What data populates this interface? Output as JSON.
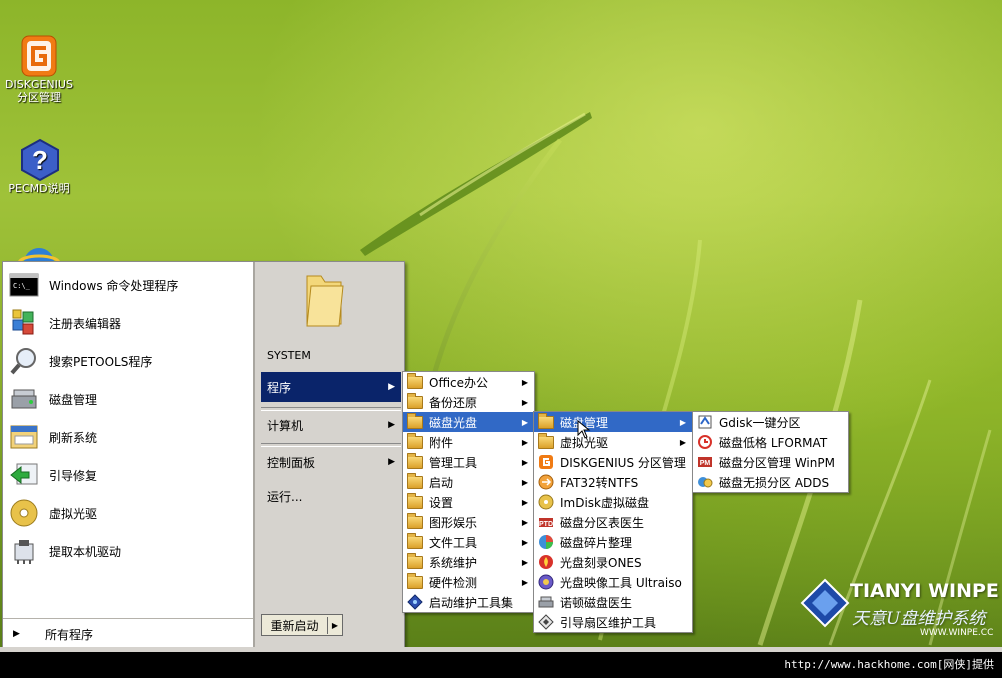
{
  "desktop": {
    "icons": [
      {
        "label1": "DISKGENIUS",
        "label2": "分区管理",
        "icon": "diskgenius-icon"
      },
      {
        "label1": "PECMD说明",
        "label2": "",
        "icon": "help-icon"
      },
      {
        "label1": "",
        "label2": "",
        "icon": "ie-icon"
      }
    ],
    "logo": {
      "title": "TIANYI WINPE",
      "subtitle": "天意U盘维护系统",
      "url": "WWW.WINPE.CC"
    }
  },
  "start_menu": {
    "left_items": [
      {
        "label": "Windows 命令处理程序",
        "icon": "cmd-icon"
      },
      {
        "label": "注册表编辑器",
        "icon": "registry-icon"
      },
      {
        "label": "搜索PETOOLS程序",
        "icon": "search-icon"
      },
      {
        "label": "磁盘管理",
        "icon": "disk-management-icon"
      },
      {
        "label": "刷新系统",
        "icon": "refresh-icon"
      },
      {
        "label": "引导修复",
        "icon": "boot-repair-icon"
      },
      {
        "label": "虚拟光驱",
        "icon": "virtual-cd-icon"
      },
      {
        "label": "提取本机驱动",
        "icon": "driver-icon"
      }
    ],
    "all_programs": "所有程序",
    "user_folder_label": "SYSTEM",
    "right_items": {
      "programs": "程序",
      "computer": "计算机",
      "control_panel": "控制面板",
      "run": "运行..."
    },
    "restart": "重新启动"
  },
  "programs_menu": {
    "items": [
      {
        "label": "Office办公",
        "submenu": true
      },
      {
        "label": "备份还原",
        "submenu": true
      },
      {
        "label": "磁盘光盘",
        "submenu": true,
        "selected": true
      },
      {
        "label": "附件",
        "submenu": true
      },
      {
        "label": "管理工具",
        "submenu": true
      },
      {
        "label": "启动",
        "submenu": true
      },
      {
        "label": "设置",
        "submenu": true
      },
      {
        "label": "图形娱乐",
        "submenu": true
      },
      {
        "label": "文件工具",
        "submenu": true
      },
      {
        "label": "系统维护",
        "submenu": true
      },
      {
        "label": "硬件检测",
        "submenu": true
      },
      {
        "label": "启动维护工具集",
        "submenu": false
      }
    ]
  },
  "disk_menu": {
    "items": [
      {
        "label": "磁盘管理",
        "submenu": true,
        "selected": true
      },
      {
        "label": "虚拟光驱",
        "submenu": true
      },
      {
        "label": "DISKGENIUS 分区管理",
        "submenu": false
      },
      {
        "label": "FAT32转NTFS",
        "submenu": false
      },
      {
        "label": "ImDisk虚拟磁盘",
        "submenu": false
      },
      {
        "label": "磁盘分区表医生",
        "submenu": false
      },
      {
        "label": "磁盘碎片整理",
        "submenu": false
      },
      {
        "label": "光盘刻录ONES",
        "submenu": false
      },
      {
        "label": "光盘映像工具 Ultraiso",
        "submenu": false
      },
      {
        "label": "诺顿磁盘医生",
        "submenu": false
      },
      {
        "label": "引导扇区维护工具",
        "submenu": false
      }
    ]
  },
  "disk_mgmt_menu": {
    "items": [
      {
        "label": "Gdisk一键分区"
      },
      {
        "label": "磁盘低格 LFORMAT"
      },
      {
        "label": "磁盘分区管理 WinPM"
      },
      {
        "label": "磁盘无损分区 ADDS"
      }
    ]
  },
  "footer": {
    "credit": "http://www.hackhome.com[网侠]提供"
  }
}
